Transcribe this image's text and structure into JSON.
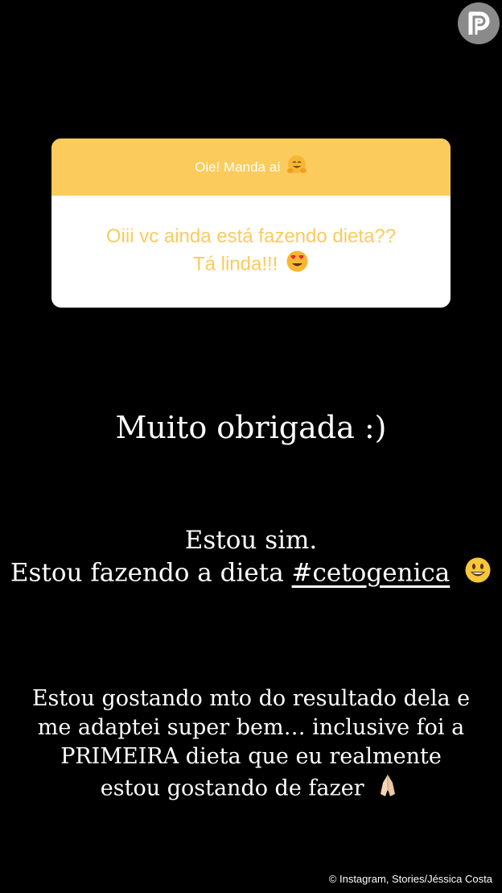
{
  "question_card": {
    "header": "Oie! Manda aí",
    "header_emoji": "hugging-face-emoji",
    "question_line1": "Oiii vc ainda está  fazendo dieta??",
    "question_line2": "Tá linda!!!",
    "question_emoji": "heart-eyes-emoji",
    "colors": {
      "accent": "#fbcb5c",
      "background": "#ffffff"
    }
  },
  "texts": {
    "thanks": "Muito obrigada :)",
    "reply_line1": "Estou sim.",
    "reply_line2_prefix": "Estou fazendo a dieta ",
    "reply_hashtag": "#cetogenica",
    "reply_emoji": "smiling-face-emoji",
    "long_line1": "Estou gostando mto do resultado dela e",
    "long_line2": "me adaptei super bem… inclusive foi a",
    "long_line3": "PRIMEIRA dieta que eu realmente",
    "long_line4": "estou gostando de fazer",
    "long_emoji": "folded-hands-emoji"
  },
  "logo_icon": "purepeople-logo-icon",
  "credit": "© Instagram, Stories/Jéssica Costa"
}
